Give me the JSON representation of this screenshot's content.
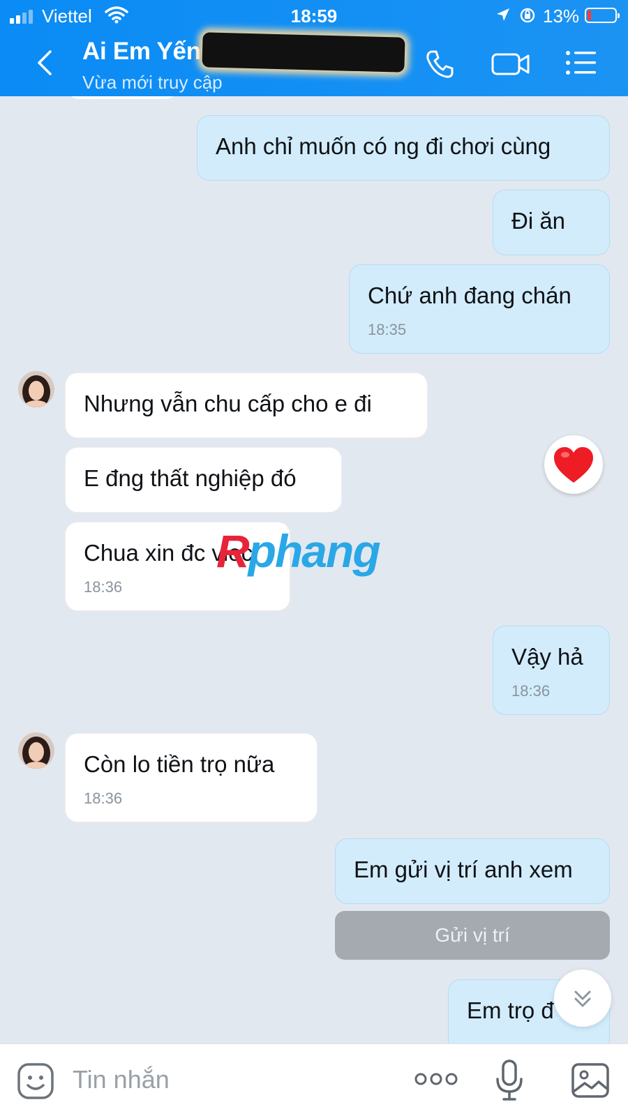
{
  "status_bar": {
    "carrier": "Viettel",
    "time": "18:59",
    "battery": "13%"
  },
  "header": {
    "contact_name": "Ai Em Yến",
    "contact_status": "Vừa mới truy cập"
  },
  "messages": [
    {
      "side": "out",
      "text": "Anh chỉ muốn có ng đi chơi cùng",
      "time": ""
    },
    {
      "side": "out",
      "text": "Đi ăn",
      "time": ""
    },
    {
      "side": "out",
      "text": "Chứ anh đang chán",
      "time": "18:35"
    },
    {
      "side": "in",
      "text": "Nhưng vẫn chu cấp cho e đi",
      "time": ""
    },
    {
      "side": "in",
      "text": "E đng thất nghiệp đó",
      "time": ""
    },
    {
      "side": "in",
      "text": "Chua xin đc viec",
      "time": "18:36"
    },
    {
      "side": "out",
      "text": "Vậy hả",
      "time": "18:36"
    },
    {
      "side": "in",
      "text": "Còn lo tiền trọ nữa",
      "time": "18:36"
    },
    {
      "side": "out",
      "text": "Em gửi vị trí anh xem",
      "time": ""
    },
    {
      "side": "out",
      "text": "Em trọ đ",
      "time": ""
    }
  ],
  "reaction": {
    "icon": "heart-icon",
    "color": "#ee1c25"
  },
  "location_request": {
    "label": "Gửi vị trí"
  },
  "watermark": {
    "part1": "R",
    "part2": "phang"
  },
  "composer": {
    "placeholder": "Tin nhắn"
  },
  "colors": {
    "header": "#1a90f5",
    "outgoing_bubble": "#d2ecfb",
    "incoming_bubble": "#ffffff",
    "chat_background": "#e2e8ef"
  }
}
